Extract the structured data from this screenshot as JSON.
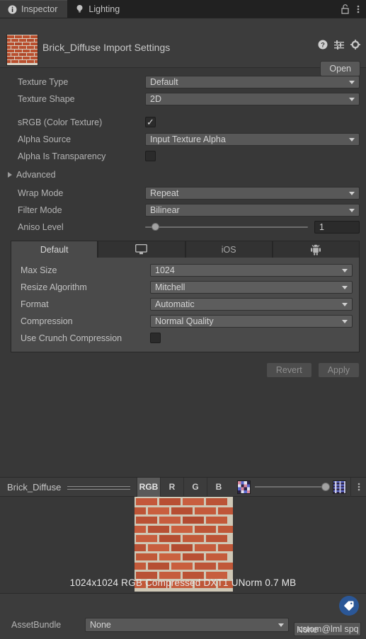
{
  "window": {
    "tabs": [
      {
        "label": "Inspector",
        "icon": "info-icon",
        "active": true
      },
      {
        "label": "Lighting",
        "icon": "lightbulb-icon",
        "active": false
      }
    ],
    "lock_icon": "lock-icon",
    "menu_icon": "kebab-menu-icon"
  },
  "object_header": {
    "title": "Brick_Diffuse Import Settings",
    "thumbnail_icon": "brick-texture-thumbnail",
    "help_icon": "help-icon",
    "preset_icon": "preset-icon",
    "settings_icon": "gear-icon",
    "open_label": "Open"
  },
  "settings": {
    "rows": [
      {
        "label": "Texture Type",
        "type": "dropdown",
        "value": "Default"
      },
      {
        "label": "Texture Shape",
        "type": "dropdown",
        "value": "2D"
      },
      {
        "label": "sRGB (Color Texture)",
        "type": "checkbox",
        "checked": true
      },
      {
        "label": "Alpha Source",
        "type": "dropdown",
        "value": "Input Texture Alpha"
      },
      {
        "label": "Alpha Is Transparency",
        "type": "checkbox",
        "checked": false
      }
    ],
    "advanced": {
      "label": "Advanced",
      "expanded": false,
      "icon": "foldout-arrow-icon"
    },
    "advanced_rows": [
      {
        "label": "Wrap Mode",
        "type": "dropdown",
        "value": "Repeat"
      },
      {
        "label": "Filter Mode",
        "type": "dropdown",
        "value": "Bilinear"
      }
    ],
    "aniso": {
      "label": "Aniso Level",
      "value": "1",
      "slider_percent": 4
    }
  },
  "platform": {
    "tabs": [
      {
        "label": "Default",
        "icon": "",
        "active": true
      },
      {
        "label": "",
        "icon": "standalone-monitor-icon",
        "active": false
      },
      {
        "label": "iOS",
        "icon": "",
        "active": false
      },
      {
        "label": "",
        "icon": "android-robot-icon",
        "active": false
      }
    ],
    "rows": [
      {
        "label": "Max Size",
        "type": "dropdown",
        "value": "1024"
      },
      {
        "label": "Resize Algorithm",
        "type": "dropdown",
        "value": "Mitchell"
      },
      {
        "label": "Format",
        "type": "dropdown",
        "value": "Automatic"
      },
      {
        "label": "Compression",
        "type": "dropdown",
        "value": "Normal Quality"
      },
      {
        "label": "Use Crunch Compression",
        "type": "checkbox",
        "checked": false
      }
    ]
  },
  "actions": {
    "revert_label": "Revert",
    "apply_label": "Apply"
  },
  "preview": {
    "name": "Brick_Diffuse",
    "channels": [
      {
        "label": "RGB",
        "selected": true
      },
      {
        "label": "R",
        "selected": false
      },
      {
        "label": "G",
        "selected": false
      },
      {
        "label": "B",
        "selected": false
      }
    ],
    "mip_min_icon": "mip-small-icon",
    "mip_max_icon": "mip-large-icon",
    "mip_slider_percent": 100,
    "menu_icon": "kebab-menu-icon",
    "image_icon": "brick-wall-preview",
    "info": "1024x1024  RGB Compressed DXT1 UNorm   0.7 MB"
  },
  "footer": {
    "tag_badge_icon": "label-tag-icon",
    "assetbundle_label": "AssetBundle",
    "assetbundle_value": "None",
    "variant_value": "cstom@lml spq"
  },
  "colors": {
    "window_bg": "#383838",
    "panel_bg": "#3c3c3c",
    "platform_bg": "#4a4a4a",
    "tabstrip_bg": "#212121",
    "control_bg": "#585858",
    "text": "#b4b4b4",
    "badge_blue": "#2b5797"
  }
}
